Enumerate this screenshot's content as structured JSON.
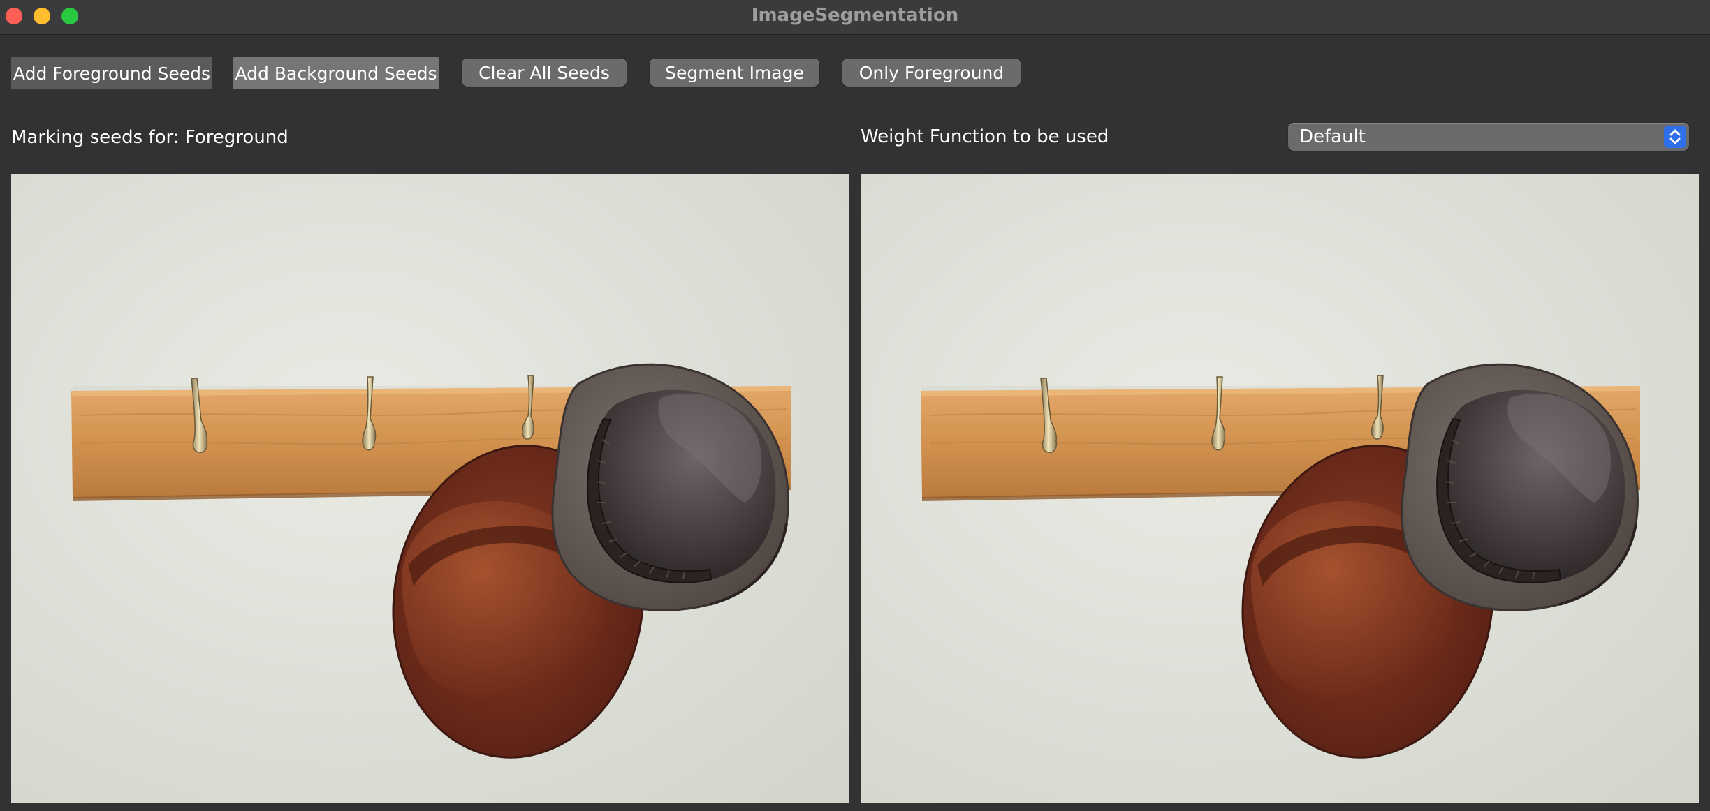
{
  "window": {
    "title": "ImageSegmentation"
  },
  "toolbar": {
    "add_foreground_seeds": "Add Foreground Seeds",
    "add_background_seeds": "Add Background Seeds",
    "clear_all_seeds": "Clear All Seeds",
    "segment_image": "Segment Image",
    "only_foreground": "Only Foreground"
  },
  "status": {
    "marking_seeds": "Marking seeds for: Foreground"
  },
  "weight": {
    "label": "Weight Function to be used",
    "selected": "Default"
  },
  "panels": {
    "input_image": "hats-on-coat-rack",
    "output_image": "hats-on-coat-rack"
  },
  "colors": {
    "window_bg": "#323232",
    "titlebar_bg": "#3b3a3c",
    "accent_blue": "#2f6fea"
  }
}
